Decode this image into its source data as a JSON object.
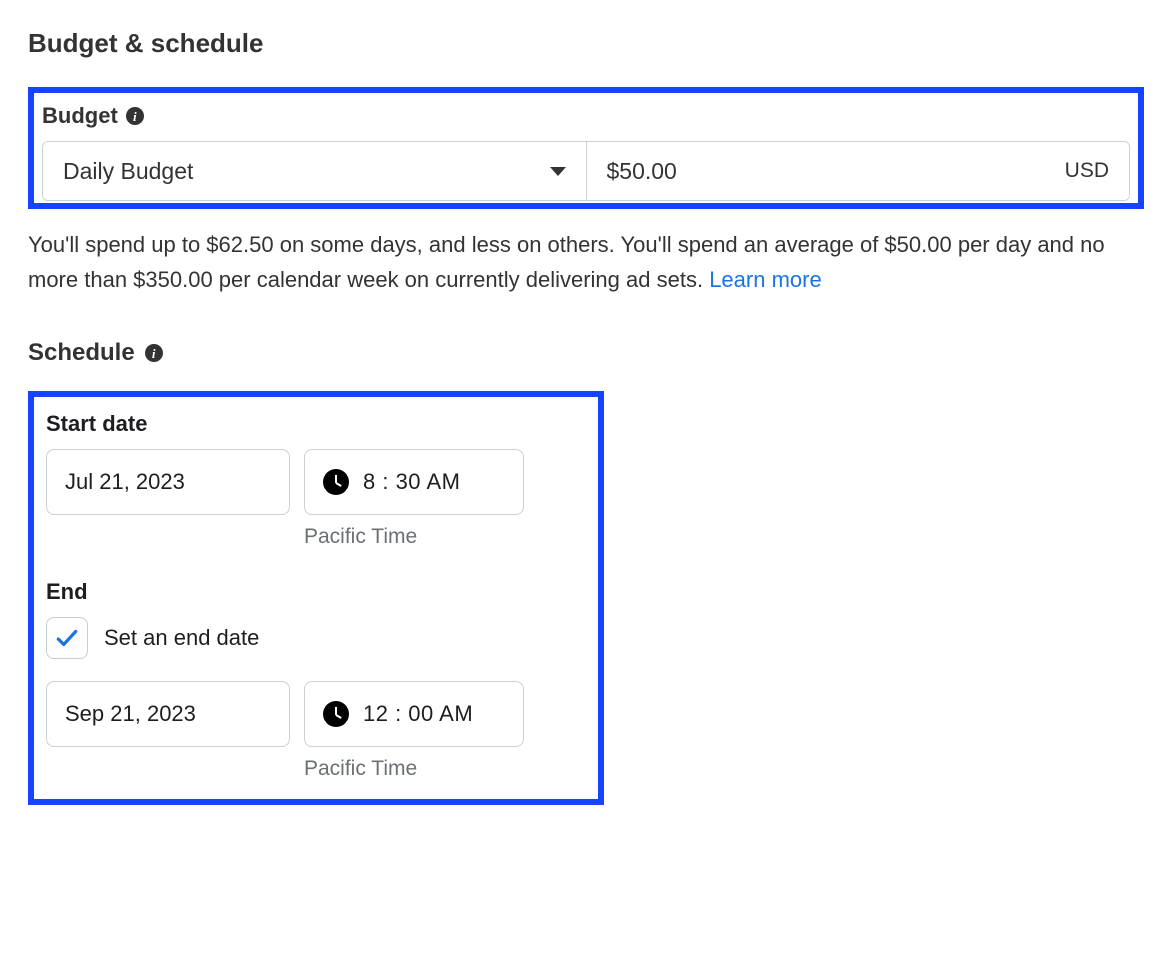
{
  "title": "Budget & schedule",
  "budget": {
    "label": "Budget",
    "type": "Daily Budget",
    "amount": "$50.00",
    "currency": "USD",
    "helper": "You'll spend up to $62.50 on some days, and less on others. You'll spend an average of $50.00 per day and no more than $350.00 per calendar week on currently delivering ad sets. ",
    "learn_more": "Learn more"
  },
  "schedule": {
    "label": "Schedule",
    "start_label": "Start date",
    "start_date": "Jul 21, 2023",
    "start_time": "8 : 30 AM",
    "start_tz": "Pacific Time",
    "end_label": "End",
    "set_end_label": "Set an end date",
    "set_end_checked": true,
    "end_date": "Sep 21, 2023",
    "end_time": "12 : 00 AM",
    "end_tz": "Pacific Time"
  }
}
